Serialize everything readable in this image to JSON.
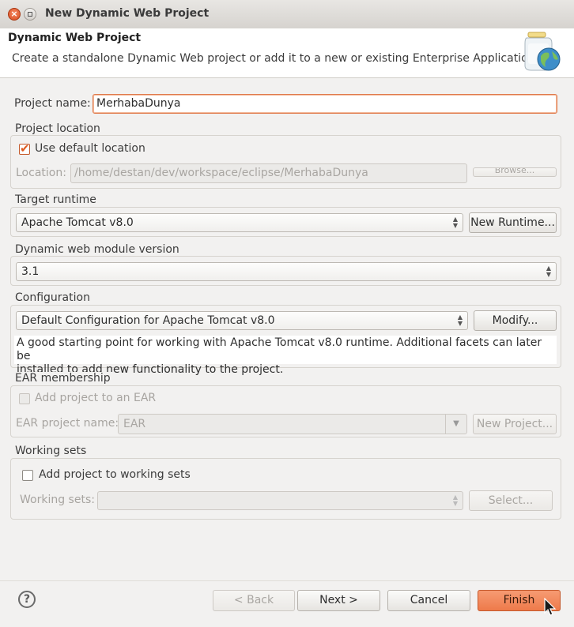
{
  "window": {
    "title": "New Dynamic Web Project"
  },
  "banner": {
    "title": "Dynamic Web Project",
    "description": "Create a standalone Dynamic Web project or add it to a new or existing Enterprise Application.",
    "icon": "jar-globe-icon"
  },
  "project_name": {
    "label": "Project name:",
    "value": "MerhabaDunya"
  },
  "project_location": {
    "group_title": "Project location",
    "use_default_label": "Use default location",
    "use_default_checked": true,
    "location_label": "Location:",
    "location_value": "/home/destan/dev/workspace/eclipse/MerhabaDunya",
    "browse_label": "Browse..."
  },
  "target_runtime": {
    "group_title": "Target runtime",
    "value": "Apache Tomcat v8.0",
    "new_runtime_label": "New Runtime..."
  },
  "module_version": {
    "group_title": "Dynamic web module version",
    "value": "3.1"
  },
  "configuration": {
    "group_title": "Configuration",
    "value": "Default Configuration for Apache Tomcat v8.0",
    "modify_label": "Modify...",
    "description_line1": "A good starting point for working with Apache Tomcat v8.0 runtime. Additional facets can later be",
    "description_line2": "installed to add new functionality to the project."
  },
  "ear_membership": {
    "group_title": "EAR membership",
    "add_to_ear_label": "Add project to an EAR",
    "add_to_ear_checked": false,
    "ear_project_label": "EAR project name:",
    "ear_project_value": "EAR",
    "new_project_label": "New Project..."
  },
  "working_sets": {
    "group_title": "Working sets",
    "add_label": "Add project to working sets",
    "add_checked": false,
    "sets_label": "Working sets:",
    "sets_value": "",
    "select_label": "Select..."
  },
  "footer": {
    "help_icon": "help-icon",
    "back_label": "< Back",
    "next_label": "Next >",
    "cancel_label": "Cancel",
    "finish_label": "Finish"
  },
  "colors": {
    "accent": "#ee7a4a",
    "background": "#f2f1f0",
    "disabled_text": "#a7a4a0"
  }
}
